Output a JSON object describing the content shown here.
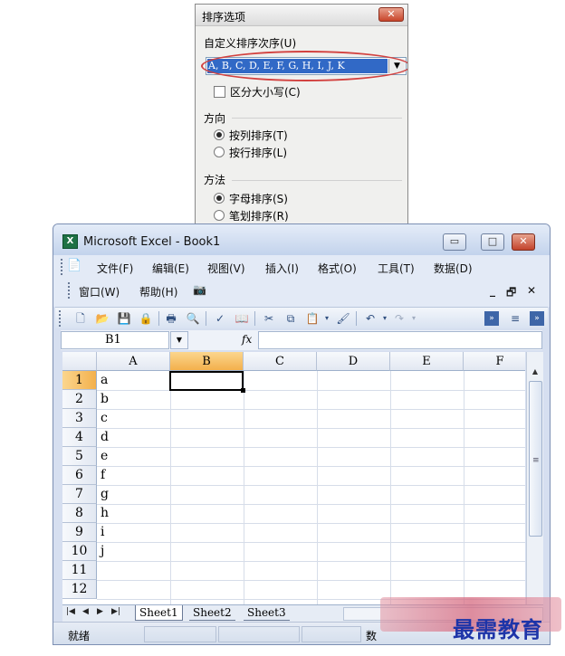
{
  "dialog": {
    "title": "排序选项",
    "close": "✕",
    "custom_order_label": "自定义排序次序(U)",
    "custom_order_value": "A, B, C, D, E, F, G, H, I, J, K",
    "case_sensitive_label": "区分大小写(C)",
    "case_sensitive": false,
    "direction_label": "方向",
    "direction_options": [
      "按列排序(T)",
      "按行排序(L)"
    ],
    "direction_selected": "按列排序(T)",
    "method_label": "方法",
    "method_options": [
      "字母排序(S)",
      "笔划排序(R)"
    ],
    "method_selected": "字母排序(S)",
    "highlight_color": "#d2413f"
  },
  "excel": {
    "title": "Microsoft Excel - Book1",
    "menus": [
      "文件(F)",
      "编辑(E)",
      "视图(V)",
      "插入(I)",
      "格式(O)",
      "工具(T)",
      "数据(D)"
    ],
    "menus2": [
      "窗口(W)",
      "帮助(H)"
    ],
    "name_box": "B1",
    "fx": "fx",
    "columns": [
      "A",
      "B",
      "C",
      "D",
      "E",
      "F"
    ],
    "active_column": "B",
    "rows": [
      "1",
      "2",
      "3",
      "4",
      "5",
      "6",
      "7",
      "8",
      "9",
      "10",
      "11",
      "12"
    ],
    "active_row": "1",
    "column_a_values": [
      "a",
      "b",
      "c",
      "d",
      "e",
      "f",
      "g",
      "h",
      "i",
      "j"
    ],
    "sheets": [
      "Sheet1",
      "Sheet2",
      "Sheet3"
    ],
    "active_sheet": "Sheet1",
    "status": "就绪",
    "status_right": "数"
  },
  "watermark": {
    "text": "最需教育"
  }
}
